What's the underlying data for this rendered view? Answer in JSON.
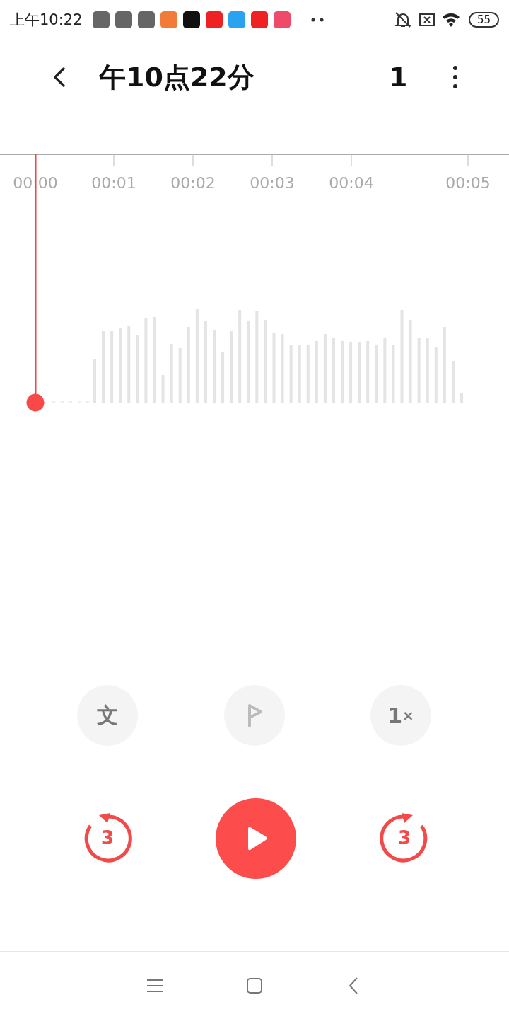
{
  "status_bar": {
    "time": "上午10:22",
    "battery": "55"
  },
  "header": {
    "title": "午10点22分",
    "date": "1"
  },
  "timeline": {
    "ticks": [
      "00:00",
      "00:01",
      "00:02",
      "00:03",
      "00:04",
      "00:05"
    ]
  },
  "tools": [
    {
      "kind": "transcribe",
      "label": "文",
      "disabled": false
    },
    {
      "kind": "flag",
      "disabled": true
    },
    {
      "kind": "speed",
      "value": "1",
      "unit": "×",
      "disabled": false
    }
  ],
  "playback": {
    "rewind": "3",
    "forward": "3",
    "playing": false
  }
}
